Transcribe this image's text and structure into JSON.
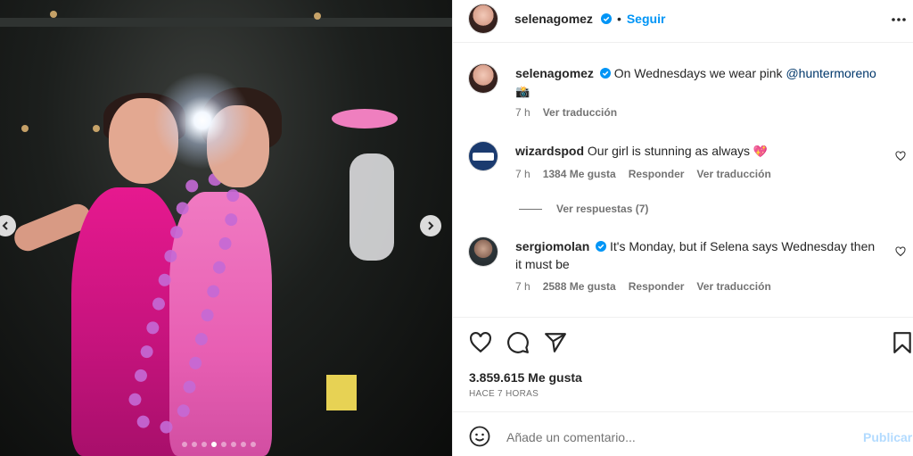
{
  "photo": {
    "carousel_dots": 8,
    "active_dot": 3
  },
  "header": {
    "username": "selenagomez",
    "separator": "•",
    "follow_label": "Seguir"
  },
  "caption": {
    "username": "selenagomez",
    "text": "On Wednesdays we wear pink",
    "mention": "@huntermoreno",
    "emoji": "📸",
    "time": "7 h",
    "translate": "Ver traducción"
  },
  "comments": [
    {
      "username": "wizardspod",
      "text": "Our girl is stunning as always",
      "emoji": "💖",
      "time": "7 h",
      "likes": "1384 Me gusta",
      "reply": "Responder",
      "translate": "Ver traducción",
      "view_replies": "Ver respuestas (7)"
    },
    {
      "username": "sergiomolan",
      "text": "It's Monday, but if Selena says Wednesday then it must be",
      "time": "7 h",
      "likes": "2588 Me gusta",
      "reply": "Responder",
      "translate": "Ver traducción"
    }
  ],
  "footer": {
    "likes": "3.859.615 Me gusta",
    "time_ago": "HACE 7 HORAS",
    "comment_placeholder": "Añade un comentario...",
    "publish_label": "Publicar"
  },
  "colors": {
    "accent": "#0095f6",
    "verified": "#0095f6",
    "secondary_text": "#737373",
    "mention": "#00376b"
  }
}
